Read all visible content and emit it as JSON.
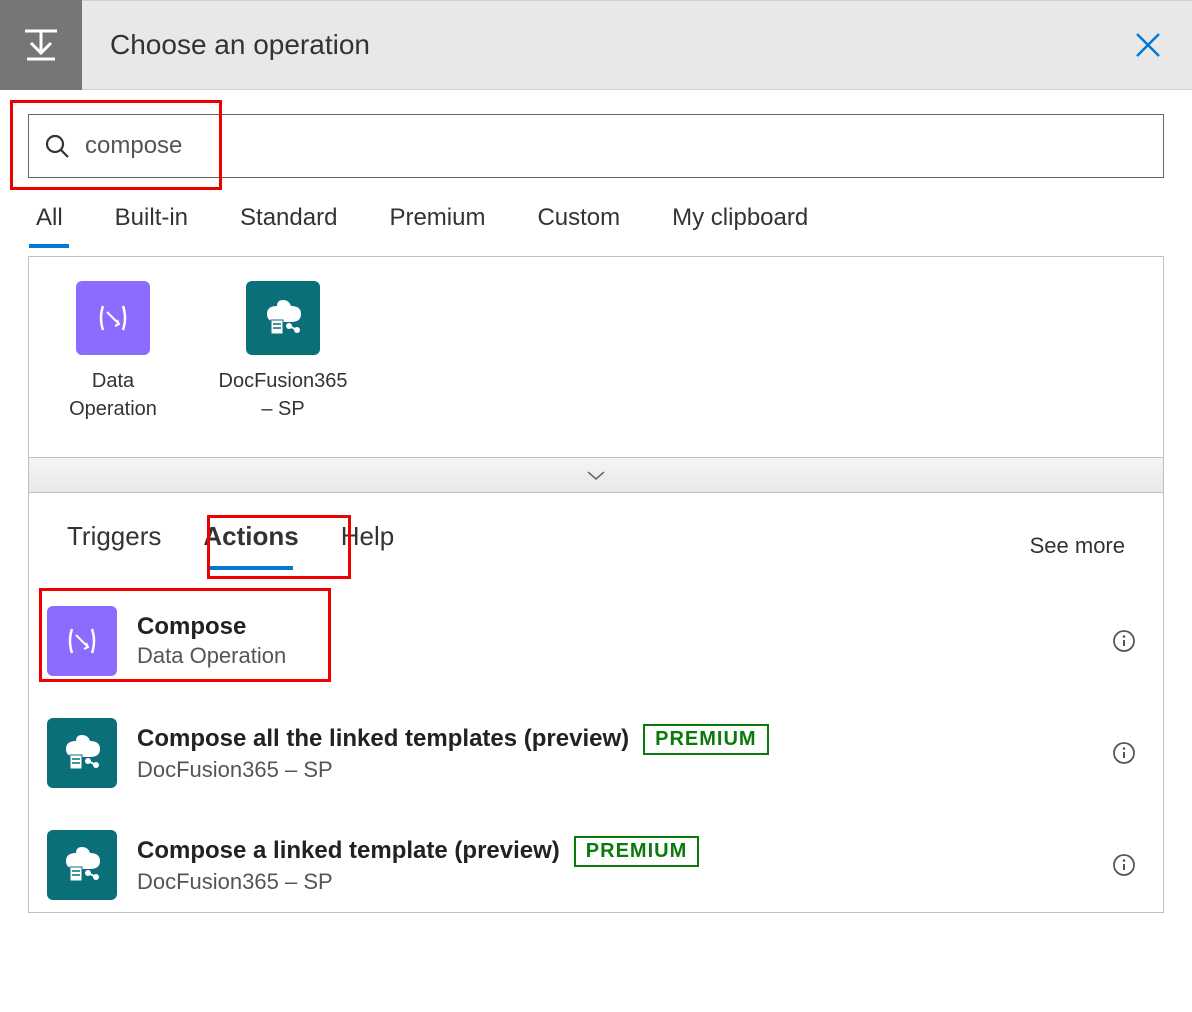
{
  "header": {
    "title": "Choose an operation"
  },
  "search": {
    "value": "compose"
  },
  "filters": {
    "tabs": [
      {
        "label": "All",
        "active": true
      },
      {
        "label": "Built-in"
      },
      {
        "label": "Standard"
      },
      {
        "label": "Premium"
      },
      {
        "label": "Custom"
      },
      {
        "label": "My clipboard"
      }
    ]
  },
  "connectors": [
    {
      "name": "Data Operation",
      "iconType": "data-op"
    },
    {
      "name": "DocFusion365 – SP",
      "iconType": "docfusion"
    }
  ],
  "subTabs": {
    "items": [
      {
        "label": "Triggers"
      },
      {
        "label": "Actions",
        "active": true
      },
      {
        "label": "Help"
      }
    ],
    "seeMore": "See more"
  },
  "actions": [
    {
      "title": "Compose",
      "subtitle": "Data Operation",
      "iconType": "data-op",
      "premium": false
    },
    {
      "title": "Compose all the linked templates (preview)",
      "subtitle": "DocFusion365 – SP",
      "iconType": "docfusion",
      "premium": true,
      "premiumLabel": "PREMIUM"
    },
    {
      "title": "Compose a linked template (preview)",
      "subtitle": "DocFusion365 – SP",
      "iconType": "docfusion",
      "premium": true,
      "premiumLabel": "PREMIUM"
    }
  ]
}
